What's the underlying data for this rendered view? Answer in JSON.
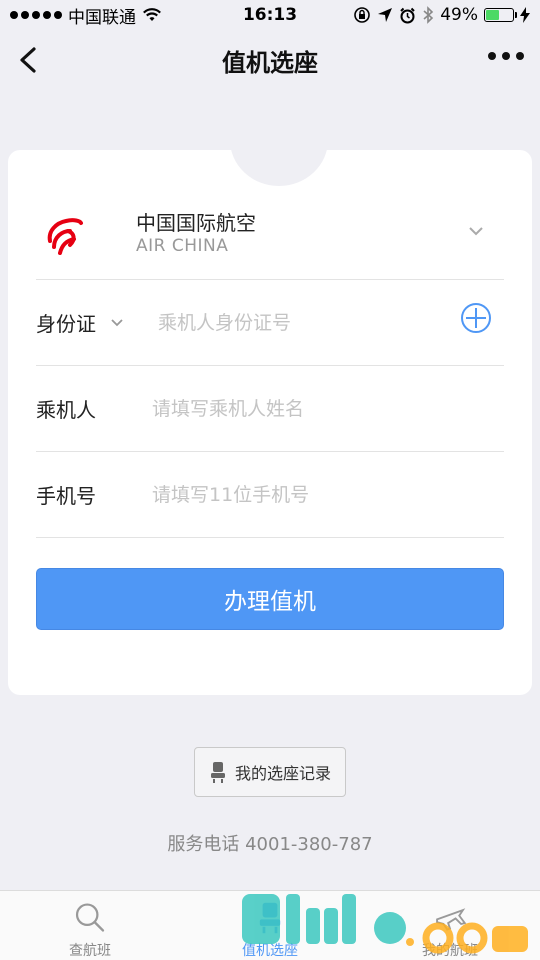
{
  "status_bar": {
    "carrier": "中国联通",
    "time": "16:13",
    "battery": "49%",
    "battery_level": 0.49
  },
  "nav": {
    "title": "值机选座"
  },
  "airline": {
    "name": "中国国际航空",
    "name_en": "AIR CHINA",
    "logo_color": "#e60012"
  },
  "form": {
    "id_type_label": "身份证",
    "id_placeholder": "乘机人身份证号",
    "passenger_label": "乘机人",
    "passenger_placeholder": "请填写乘机人姓名",
    "phone_label": "手机号",
    "phone_placeholder": "请填写11位手机号",
    "submit_label": "办理值机"
  },
  "record_button": {
    "label": "我的选座记录"
  },
  "service_phone": "服务电话 4001-380-787",
  "tabs": [
    {
      "label": "查航班",
      "icon": "search-icon",
      "active": false
    },
    {
      "label": "值机选座",
      "icon": "seat-icon",
      "active": true
    },
    {
      "label": "我的航班",
      "icon": "plane-icon",
      "active": false
    }
  ],
  "colors": {
    "accent": "#4f97f5",
    "background": "#efeff4",
    "battery_fill": "#4cd964"
  }
}
